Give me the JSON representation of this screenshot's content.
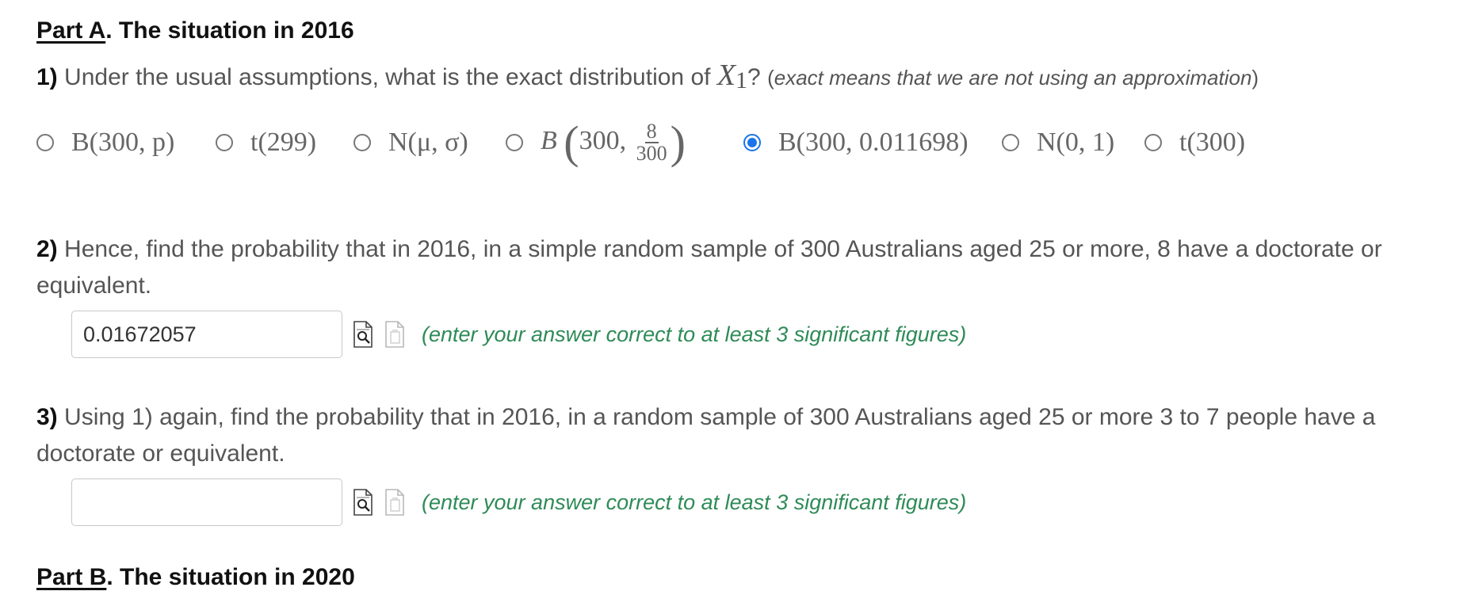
{
  "partA": {
    "prefix": "Part A",
    "rest": ". The situation in 2016"
  },
  "q1": {
    "number": "1)",
    "text_before": "Under the usual assumptions, what is the exact distribution of",
    "variable": "X",
    "subscript": "1",
    "question_mark": "?",
    "note_open": "(",
    "note": "exact means that we are not using an approximation",
    "note_close": ")",
    "selected_option": "B(300, 0.011698)",
    "options": {
      "o1": "B(300, p)",
      "o2": "t(299)",
      "o3": "N(μ, σ)",
      "o4_prefix": "B",
      "o4_num": "8",
      "o4_den": "300",
      "o4_first": "300,",
      "o5": "B(300, 0.011698)",
      "o6": "N(0, 1)",
      "o7": "t(300)"
    }
  },
  "q2": {
    "number": "2)",
    "text": "Hence, find the probability that in 2016, in a simple random sample of 300 Australians aged 25 or more, 8 have a doctorate or equivalent.",
    "input_value": "0.01672057",
    "hint": "(enter your answer correct to at least 3 significant figures)"
  },
  "q3": {
    "number": "3)",
    "text": "Using 1) again, find the probability that in 2016, in a random sample of 300 Australians aged 25 or more 3 to 7 people have a doctorate or equivalent.",
    "input_value": "",
    "hint": "(enter your answer correct to at least 3 significant figures)"
  },
  "partB": {
    "prefix": "Part B",
    "rest": ". The situation in 2020"
  },
  "icons": {
    "preview": "magnifier-page-icon",
    "paste": "paste-page-icon"
  },
  "colors": {
    "hint": "#2e8b57",
    "radio_selected": "#1a73e8"
  }
}
